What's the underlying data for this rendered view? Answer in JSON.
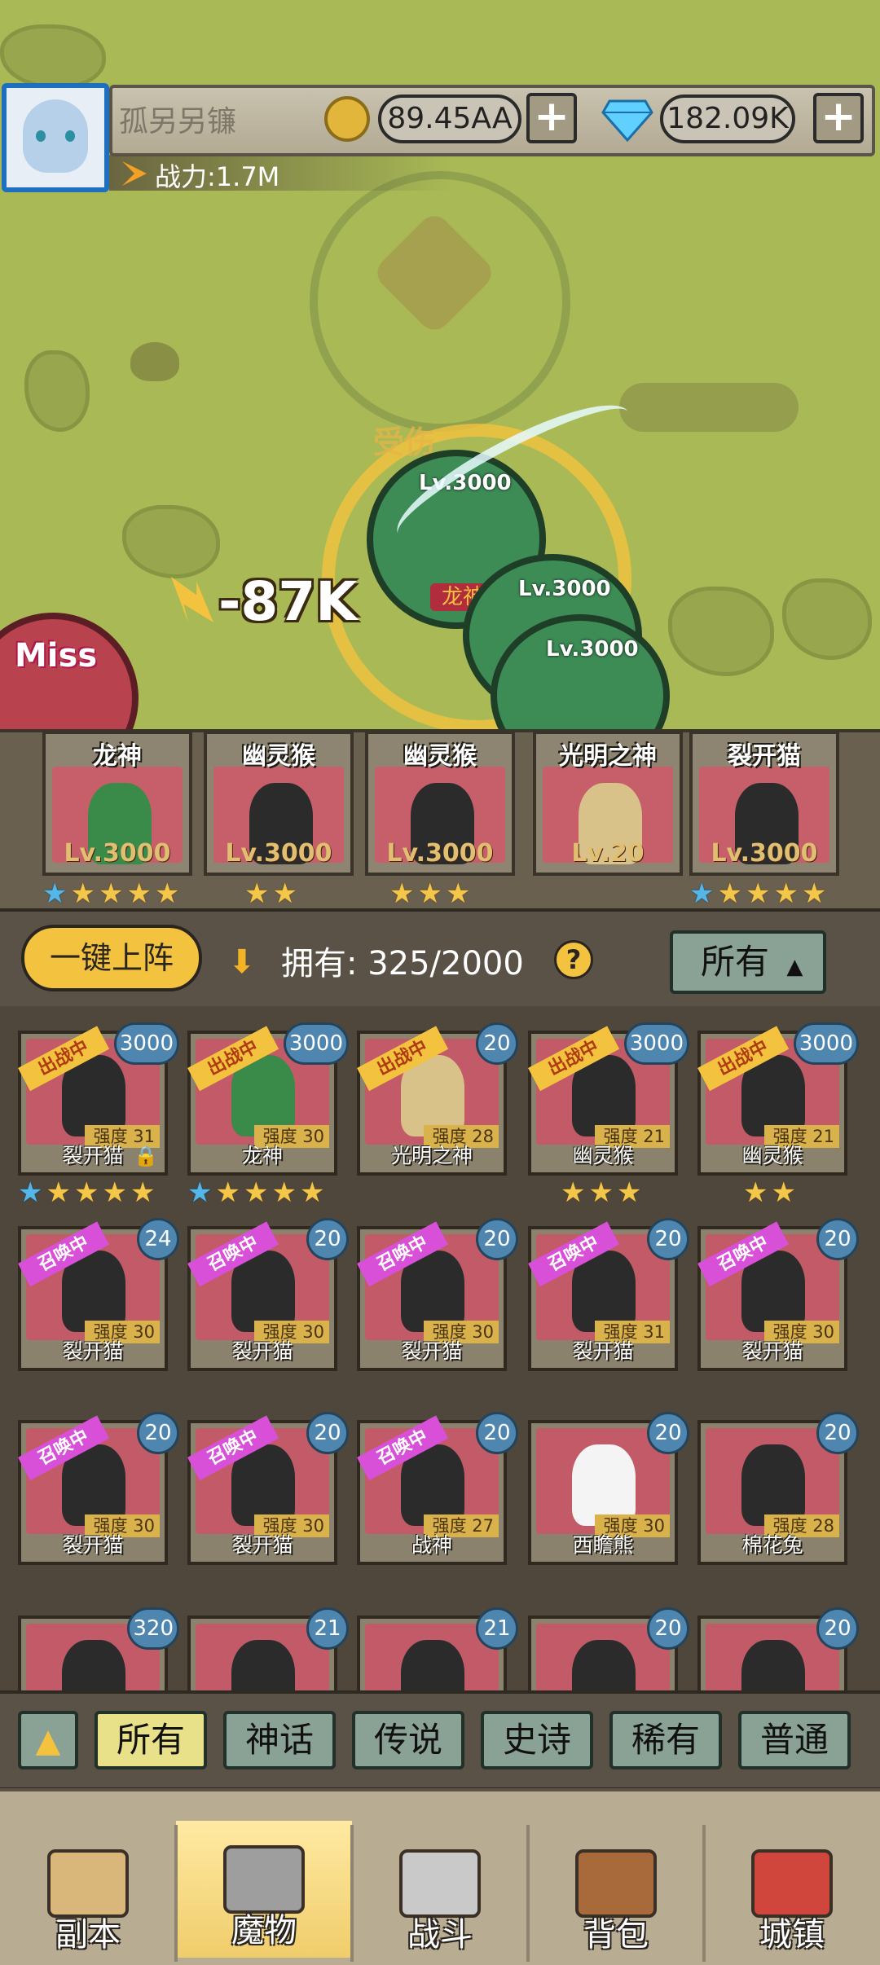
{
  "header": {
    "player_name": "孤另另镰",
    "gold": "89.45AA",
    "gems": "182.09K",
    "power": "战力:1.7M",
    "add_label": "+"
  },
  "battle": {
    "enemy_label": "受伤",
    "boss_label": "龙神",
    "damage": "-87K",
    "miss": "Miss",
    "units": [
      {
        "level": "Lv.3000"
      },
      {
        "level": "Lv.3000"
      },
      {
        "level": "Lv.3000"
      }
    ]
  },
  "team": [
    {
      "name": "龙神",
      "level": "Lv.3000",
      "blue": 1,
      "gold": 4
    },
    {
      "name": "幽灵猴",
      "level": "Lv.3000",
      "blue": 0,
      "gold": 2
    },
    {
      "name": "幽灵猴",
      "level": "Lv.3000",
      "blue": 0,
      "gold": 3
    },
    {
      "name": "光明之神",
      "level": "Lv.20",
      "blue": 0,
      "gold": 0
    },
    {
      "name": "裂开猫",
      "level": "Lv.3000",
      "blue": 1,
      "gold": 4
    }
  ],
  "controls": {
    "one_key": "一键上阵",
    "own_label": "拥有: 325/2000",
    "help": "?",
    "sort": "所有"
  },
  "grid": [
    {
      "name": "裂开猫",
      "badge": "3000",
      "strength": "强度 31",
      "ribbon": "出战中",
      "type": "battle",
      "lock": true,
      "blue": 1,
      "gold": 4
    },
    {
      "name": "龙神",
      "badge": "3000",
      "strength": "强度 30",
      "ribbon": "出战中",
      "type": "battle",
      "lock": false,
      "blue": 1,
      "gold": 4
    },
    {
      "name": "光明之神",
      "badge": "20",
      "strength": "强度 28",
      "ribbon": "出战中",
      "type": "battle",
      "lock": false,
      "blue": 0,
      "gold": 0
    },
    {
      "name": "幽灵猴",
      "badge": "3000",
      "strength": "强度 21",
      "ribbon": "出战中",
      "type": "battle",
      "lock": false,
      "blue": 0,
      "gold": 3
    },
    {
      "name": "幽灵猴",
      "badge": "3000",
      "strength": "强度 21",
      "ribbon": "出战中",
      "type": "battle",
      "lock": false,
      "blue": 0,
      "gold": 2
    },
    {
      "name": "裂开猫",
      "badge": "24",
      "strength": "强度 30",
      "ribbon": "召唤中",
      "type": "summon",
      "lock": false,
      "blue": 0,
      "gold": 0
    },
    {
      "name": "裂开猫",
      "badge": "20",
      "strength": "强度 30",
      "ribbon": "召唤中",
      "type": "summon",
      "lock": false,
      "blue": 0,
      "gold": 0
    },
    {
      "name": "裂开猫",
      "badge": "20",
      "strength": "强度 30",
      "ribbon": "召唤中",
      "type": "summon",
      "lock": false,
      "blue": 0,
      "gold": 0
    },
    {
      "name": "裂开猫",
      "badge": "20",
      "strength": "强度 31",
      "ribbon": "召唤中",
      "type": "summon",
      "lock": false,
      "blue": 0,
      "gold": 0
    },
    {
      "name": "裂开猫",
      "badge": "20",
      "strength": "强度 30",
      "ribbon": "召唤中",
      "type": "summon",
      "lock": false,
      "blue": 0,
      "gold": 0
    },
    {
      "name": "裂开猫",
      "badge": "20",
      "strength": "强度 30",
      "ribbon": "召唤中",
      "type": "summon",
      "lock": false,
      "blue": 0,
      "gold": 0
    },
    {
      "name": "裂开猫",
      "badge": "20",
      "strength": "强度 30",
      "ribbon": "召唤中",
      "type": "summon",
      "lock": false,
      "blue": 0,
      "gold": 0
    },
    {
      "name": "战神",
      "badge": "20",
      "strength": "强度 27",
      "ribbon": "召唤中",
      "type": "summon",
      "lock": false,
      "blue": 0,
      "gold": 0
    },
    {
      "name": "西瞻熊",
      "badge": "20",
      "strength": "强度 30",
      "ribbon": "",
      "type": "",
      "lock": false,
      "blue": 0,
      "gold": 0
    },
    {
      "name": "棉花兔",
      "badge": "20",
      "strength": "强度 28",
      "ribbon": "",
      "type": "",
      "lock": false,
      "blue": 0,
      "gold": 0
    },
    {
      "name": "",
      "badge": "320",
      "strength": "",
      "ribbon": "",
      "type": "",
      "lock": false,
      "blue": 0,
      "gold": 0
    },
    {
      "name": "",
      "badge": "21",
      "strength": "",
      "ribbon": "",
      "type": "",
      "lock": false,
      "blue": 0,
      "gold": 0
    },
    {
      "name": "",
      "badge": "21",
      "strength": "",
      "ribbon": "",
      "type": "",
      "lock": false,
      "blue": 0,
      "gold": 0
    },
    {
      "name": "",
      "badge": "20",
      "strength": "",
      "ribbon": "",
      "type": "",
      "lock": false,
      "blue": 0,
      "gold": 0
    },
    {
      "name": "",
      "badge": "20",
      "strength": "",
      "ribbon": "",
      "type": "",
      "lock": false,
      "blue": 0,
      "gold": 0
    }
  ],
  "filters": [
    "所有",
    "神话",
    "传说",
    "史诗",
    "稀有",
    "普通"
  ],
  "nav": [
    {
      "label": "副本",
      "icon": "map-icon"
    },
    {
      "label": "魔物",
      "icon": "monster-icon",
      "active": true
    },
    {
      "label": "战斗",
      "icon": "swords-icon"
    },
    {
      "label": "背包",
      "icon": "backpack-icon"
    },
    {
      "label": "城镇",
      "icon": "shop-icon"
    }
  ],
  "colors": {
    "battlefield": "#a8b955",
    "card": "#c25a68",
    "accent": "#f3c23e",
    "filter": "#8aa295"
  }
}
